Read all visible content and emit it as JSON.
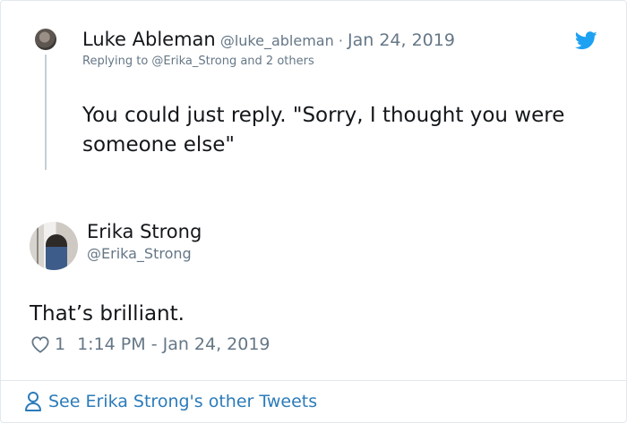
{
  "parent_tweet": {
    "name": "Luke Ableman",
    "handle": "@luke_ableman",
    "separator": " · ",
    "date": "Jan 24, 2019",
    "replying_to": "Replying to @Erika_Strong and 2 others",
    "text": "You could just reply. \"Sorry, I thought you were someone else\""
  },
  "main_tweet": {
    "name": "Erika Strong",
    "handle": "@Erika_Strong",
    "text": "That’s brilliant.",
    "likes": "1",
    "timestamp": "1:14 PM - Jan 24, 2019"
  },
  "footer": {
    "link_text": "See Erika Strong's other Tweets"
  },
  "icons": {
    "brand": "twitter-bird-icon",
    "like": "heart-icon",
    "profile": "person-icon"
  },
  "colors": {
    "brand_blue": "#1da1f2",
    "link_blue": "#2b7bb9",
    "secondary_text": "#657786",
    "primary_text": "#14171a",
    "border": "#e1e8ed"
  }
}
